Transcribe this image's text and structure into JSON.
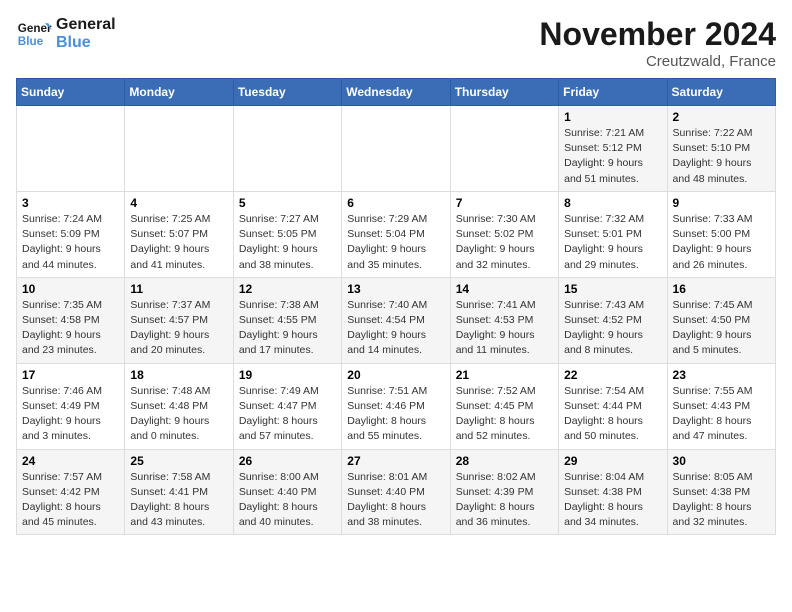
{
  "logo": {
    "line1": "General",
    "line2": "Blue"
  },
  "title": "November 2024",
  "subtitle": "Creutzwald, France",
  "weekdays": [
    "Sunday",
    "Monday",
    "Tuesday",
    "Wednesday",
    "Thursday",
    "Friday",
    "Saturday"
  ],
  "weeks": [
    [
      {
        "day": "",
        "info": ""
      },
      {
        "day": "",
        "info": ""
      },
      {
        "day": "",
        "info": ""
      },
      {
        "day": "",
        "info": ""
      },
      {
        "day": "",
        "info": ""
      },
      {
        "day": "1",
        "info": "Sunrise: 7:21 AM\nSunset: 5:12 PM\nDaylight: 9 hours\nand 51 minutes."
      },
      {
        "day": "2",
        "info": "Sunrise: 7:22 AM\nSunset: 5:10 PM\nDaylight: 9 hours\nand 48 minutes."
      }
    ],
    [
      {
        "day": "3",
        "info": "Sunrise: 7:24 AM\nSunset: 5:09 PM\nDaylight: 9 hours\nand 44 minutes."
      },
      {
        "day": "4",
        "info": "Sunrise: 7:25 AM\nSunset: 5:07 PM\nDaylight: 9 hours\nand 41 minutes."
      },
      {
        "day": "5",
        "info": "Sunrise: 7:27 AM\nSunset: 5:05 PM\nDaylight: 9 hours\nand 38 minutes."
      },
      {
        "day": "6",
        "info": "Sunrise: 7:29 AM\nSunset: 5:04 PM\nDaylight: 9 hours\nand 35 minutes."
      },
      {
        "day": "7",
        "info": "Sunrise: 7:30 AM\nSunset: 5:02 PM\nDaylight: 9 hours\nand 32 minutes."
      },
      {
        "day": "8",
        "info": "Sunrise: 7:32 AM\nSunset: 5:01 PM\nDaylight: 9 hours\nand 29 minutes."
      },
      {
        "day": "9",
        "info": "Sunrise: 7:33 AM\nSunset: 5:00 PM\nDaylight: 9 hours\nand 26 minutes."
      }
    ],
    [
      {
        "day": "10",
        "info": "Sunrise: 7:35 AM\nSunset: 4:58 PM\nDaylight: 9 hours\nand 23 minutes."
      },
      {
        "day": "11",
        "info": "Sunrise: 7:37 AM\nSunset: 4:57 PM\nDaylight: 9 hours\nand 20 minutes."
      },
      {
        "day": "12",
        "info": "Sunrise: 7:38 AM\nSunset: 4:55 PM\nDaylight: 9 hours\nand 17 minutes."
      },
      {
        "day": "13",
        "info": "Sunrise: 7:40 AM\nSunset: 4:54 PM\nDaylight: 9 hours\nand 14 minutes."
      },
      {
        "day": "14",
        "info": "Sunrise: 7:41 AM\nSunset: 4:53 PM\nDaylight: 9 hours\nand 11 minutes."
      },
      {
        "day": "15",
        "info": "Sunrise: 7:43 AM\nSunset: 4:52 PM\nDaylight: 9 hours\nand 8 minutes."
      },
      {
        "day": "16",
        "info": "Sunrise: 7:45 AM\nSunset: 4:50 PM\nDaylight: 9 hours\nand 5 minutes."
      }
    ],
    [
      {
        "day": "17",
        "info": "Sunrise: 7:46 AM\nSunset: 4:49 PM\nDaylight: 9 hours\nand 3 minutes."
      },
      {
        "day": "18",
        "info": "Sunrise: 7:48 AM\nSunset: 4:48 PM\nDaylight: 9 hours\nand 0 minutes."
      },
      {
        "day": "19",
        "info": "Sunrise: 7:49 AM\nSunset: 4:47 PM\nDaylight: 8 hours\nand 57 minutes."
      },
      {
        "day": "20",
        "info": "Sunrise: 7:51 AM\nSunset: 4:46 PM\nDaylight: 8 hours\nand 55 minutes."
      },
      {
        "day": "21",
        "info": "Sunrise: 7:52 AM\nSunset: 4:45 PM\nDaylight: 8 hours\nand 52 minutes."
      },
      {
        "day": "22",
        "info": "Sunrise: 7:54 AM\nSunset: 4:44 PM\nDaylight: 8 hours\nand 50 minutes."
      },
      {
        "day": "23",
        "info": "Sunrise: 7:55 AM\nSunset: 4:43 PM\nDaylight: 8 hours\nand 47 minutes."
      }
    ],
    [
      {
        "day": "24",
        "info": "Sunrise: 7:57 AM\nSunset: 4:42 PM\nDaylight: 8 hours\nand 45 minutes."
      },
      {
        "day": "25",
        "info": "Sunrise: 7:58 AM\nSunset: 4:41 PM\nDaylight: 8 hours\nand 43 minutes."
      },
      {
        "day": "26",
        "info": "Sunrise: 8:00 AM\nSunset: 4:40 PM\nDaylight: 8 hours\nand 40 minutes."
      },
      {
        "day": "27",
        "info": "Sunrise: 8:01 AM\nSunset: 4:40 PM\nDaylight: 8 hours\nand 38 minutes."
      },
      {
        "day": "28",
        "info": "Sunrise: 8:02 AM\nSunset: 4:39 PM\nDaylight: 8 hours\nand 36 minutes."
      },
      {
        "day": "29",
        "info": "Sunrise: 8:04 AM\nSunset: 4:38 PM\nDaylight: 8 hours\nand 34 minutes."
      },
      {
        "day": "30",
        "info": "Sunrise: 8:05 AM\nSunset: 4:38 PM\nDaylight: 8 hours\nand 32 minutes."
      }
    ]
  ]
}
